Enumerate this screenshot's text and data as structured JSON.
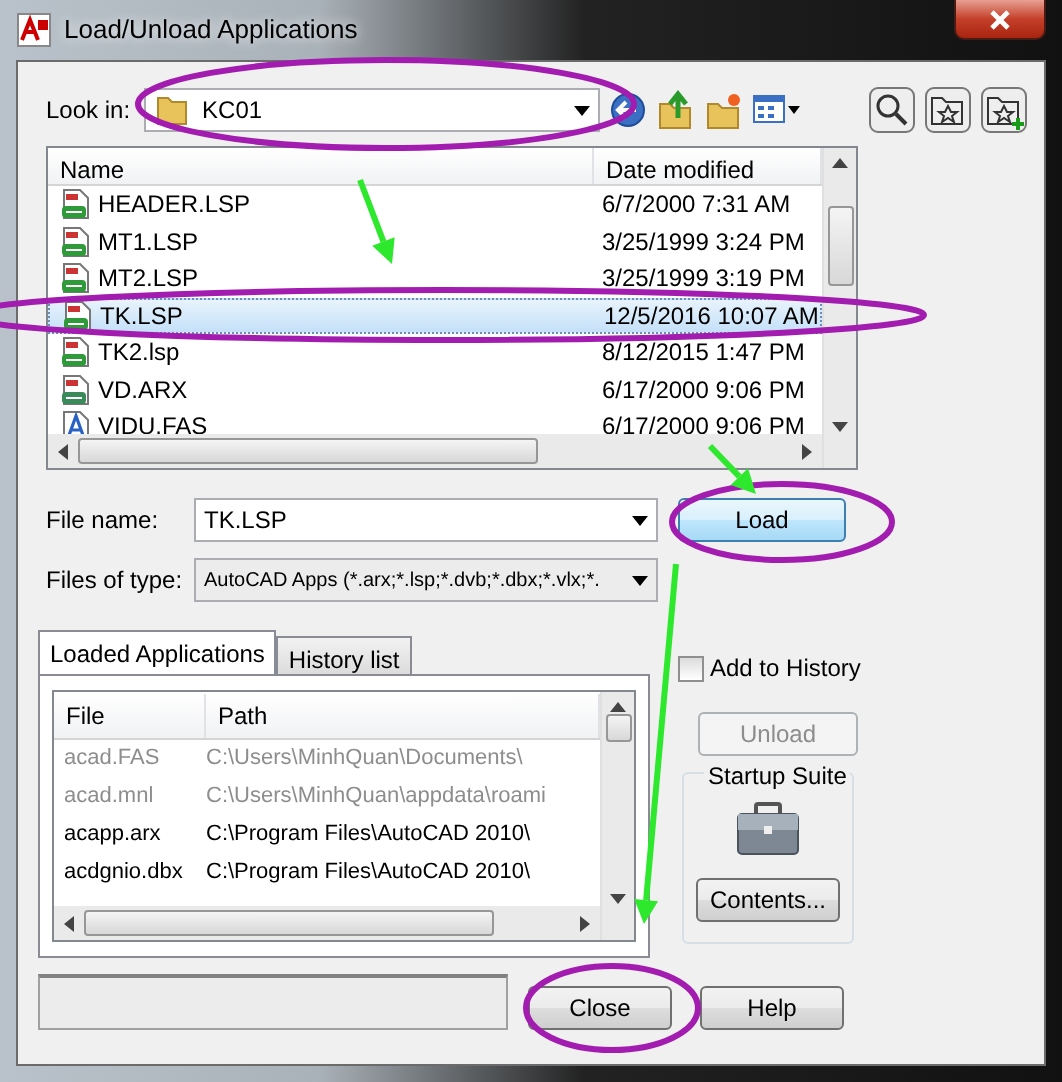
{
  "window": {
    "title": "Load/Unload Applications"
  },
  "look_in": {
    "label": "Look in:",
    "value": "KC01"
  },
  "file_list": {
    "columns": [
      "Name",
      "Date modified"
    ],
    "rows": [
      {
        "name": "HEADER.LSP",
        "date": "6/7/2000 7:31 AM",
        "kind": "lsp",
        "selected": false
      },
      {
        "name": "MT1.LSP",
        "date": "3/25/1999 3:24 PM",
        "kind": "lsp",
        "selected": false
      },
      {
        "name": "MT2.LSP",
        "date": "3/25/1999 3:19 PM",
        "kind": "lsp",
        "selected": false
      },
      {
        "name": "TK.LSP",
        "date": "12/5/2016 10:07 AM",
        "kind": "lsp",
        "selected": true
      },
      {
        "name": "TK2.lsp",
        "date": "8/12/2015 1:47 PM",
        "kind": "lsp",
        "selected": false
      },
      {
        "name": "VD.ARX",
        "date": "6/17/2000 9:06 PM",
        "kind": "arx",
        "selected": false
      },
      {
        "name": "VIDU.FAS",
        "date": "6/17/2000 9:06 PM",
        "kind": "fas",
        "selected": false
      }
    ]
  },
  "file_name": {
    "label": "File name:",
    "value": "TK.LSP"
  },
  "files_of_type": {
    "label": "Files of type:",
    "value": "AutoCAD Apps (*.arx;*.lsp;*.dvb;*.dbx;*.vlx;*."
  },
  "load_button": "Load",
  "tabs": [
    {
      "label": "Loaded Applications",
      "selected": true
    },
    {
      "label": "History list",
      "selected": false
    }
  ],
  "loaded_apps": {
    "columns": [
      "File",
      "Path"
    ],
    "rows": [
      {
        "file": "acad.FAS",
        "path": "C:\\Users\\MinhQuan\\Documents\\",
        "disabled": true
      },
      {
        "file": "acad.mnl",
        "path": "C:\\Users\\MinhQuan\\appdata\\roami",
        "disabled": true
      },
      {
        "file": "acapp.arx",
        "path": "C:\\Program Files\\AutoCAD 2010\\",
        "disabled": false
      },
      {
        "file": "acdgnio.dbx",
        "path": "C:\\Program Files\\AutoCAD 2010\\",
        "disabled": false
      }
    ]
  },
  "add_to_history": {
    "label": "Add to History",
    "checked": false
  },
  "unload_button": {
    "label": "Unload",
    "disabled": true
  },
  "startup_suite": {
    "title": "Startup Suite",
    "button": "Contents..."
  },
  "close_button": "Close",
  "help_button": "Help",
  "annotations": [
    {
      "kind": "ellipse"
    },
    {
      "kind": "ellipse"
    },
    {
      "kind": "ellipse"
    },
    {
      "kind": "ellipse"
    },
    {
      "kind": "arrow"
    },
    {
      "kind": "arrow"
    },
    {
      "kind": "arrow"
    }
  ]
}
